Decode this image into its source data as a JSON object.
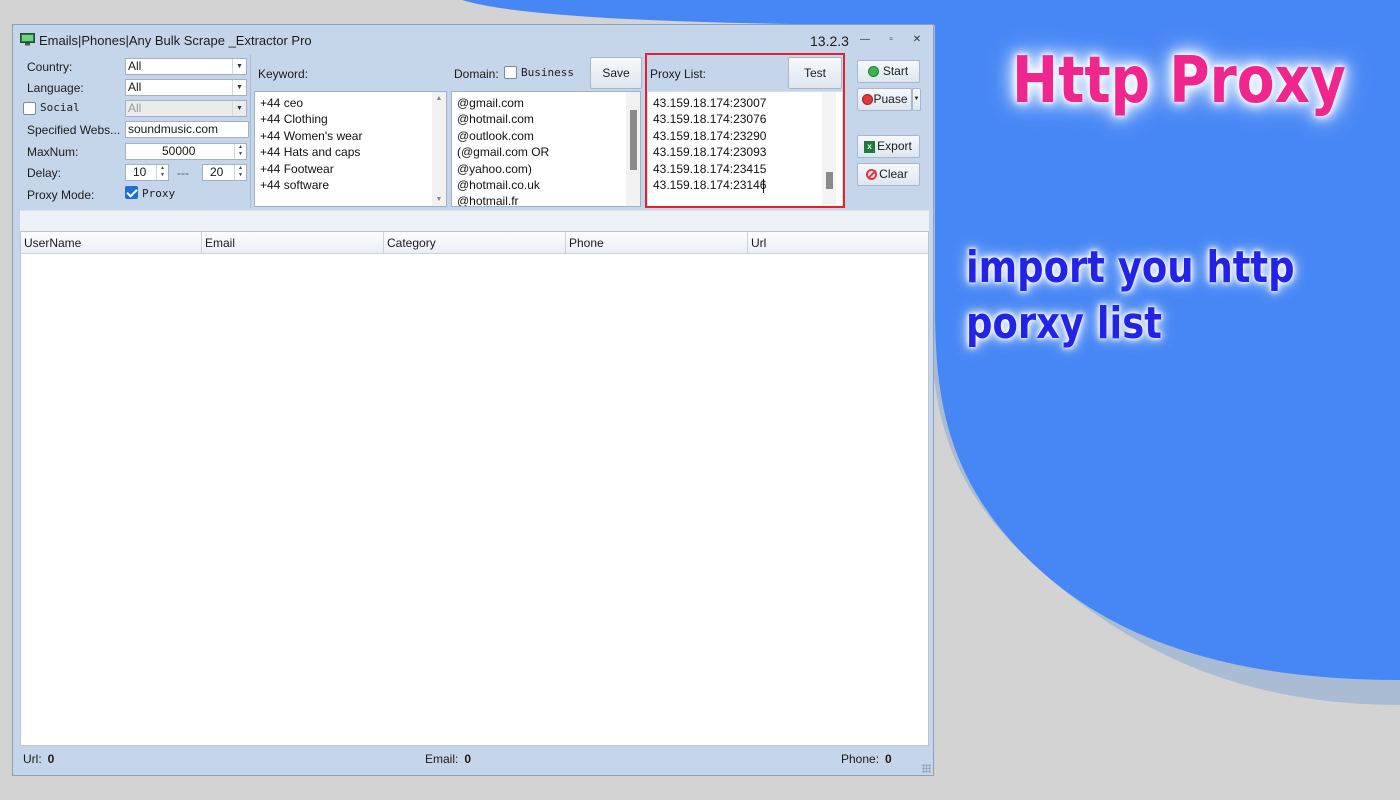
{
  "window": {
    "title": "Emails|Phones|Any Bulk Scrape _Extractor Pro",
    "version": "13.2.3",
    "minimize_glyph": "—",
    "restore_glyph": "▫",
    "close_glyph": "✕"
  },
  "settings": {
    "country_label": "Country:",
    "country_value": "All",
    "language_label": "Language:",
    "language_value": "All",
    "social_label": "Social",
    "social_value": "All",
    "website_label": "Specified Webs...",
    "website_value": "soundmusic.com",
    "maxnum_label": "MaxNum:",
    "maxnum_value": "50000",
    "delay_label": "Delay:",
    "delay_min": "10",
    "delay_separator": "---",
    "delay_max": "20",
    "proxy_mode_label": "Proxy Mode:",
    "proxy_checkbox_label": "Proxy",
    "proxy_checked": true
  },
  "keyword": {
    "label": "Keyword:",
    "items": [
      "+44 ceo",
      "+44  Clothing",
      "+44 Women's wear",
      "+44  Hats and caps",
      "+44 Footwear",
      "+44 software"
    ]
  },
  "domain": {
    "label": "Domain:",
    "business_label": "Business",
    "save_label": "Save",
    "items": [
      "@gmail.com",
      "@hotmail.com",
      "@outlook.com",
      "(@gmail.com OR",
      "@yahoo.com)",
      "@hotmail.co.uk",
      "@hotmail.fr"
    ]
  },
  "proxy": {
    "label": "Proxy List:",
    "test_label": "Test",
    "items": [
      "43.159.18.174:23007",
      "43.159.18.174:23076",
      "43.159.18.174:23290",
      "43.159.18.174:23093",
      "43.159.18.174:23415",
      "43.159.18.174:23146"
    ]
  },
  "actions": {
    "start_label": "Start",
    "pause_label": "Puase",
    "export_label": "Export",
    "clear_label": "Clear"
  },
  "table": {
    "columns": [
      "UserName",
      "Email",
      "Category",
      "Phone",
      "Url"
    ]
  },
  "status": {
    "url_label": "Url:",
    "url_count": "0",
    "email_label": "Email:",
    "email_count": "0",
    "phone_label": "Phone:",
    "phone_count": "0"
  },
  "promo": {
    "title": "Http Proxy",
    "subtitle": "import you http porxy list"
  },
  "colors": {
    "accent_blue": "#4285f4",
    "promo_pink": "#f0268e",
    "promo_blue": "#2323e8",
    "highlight_red": "#e0232e"
  }
}
